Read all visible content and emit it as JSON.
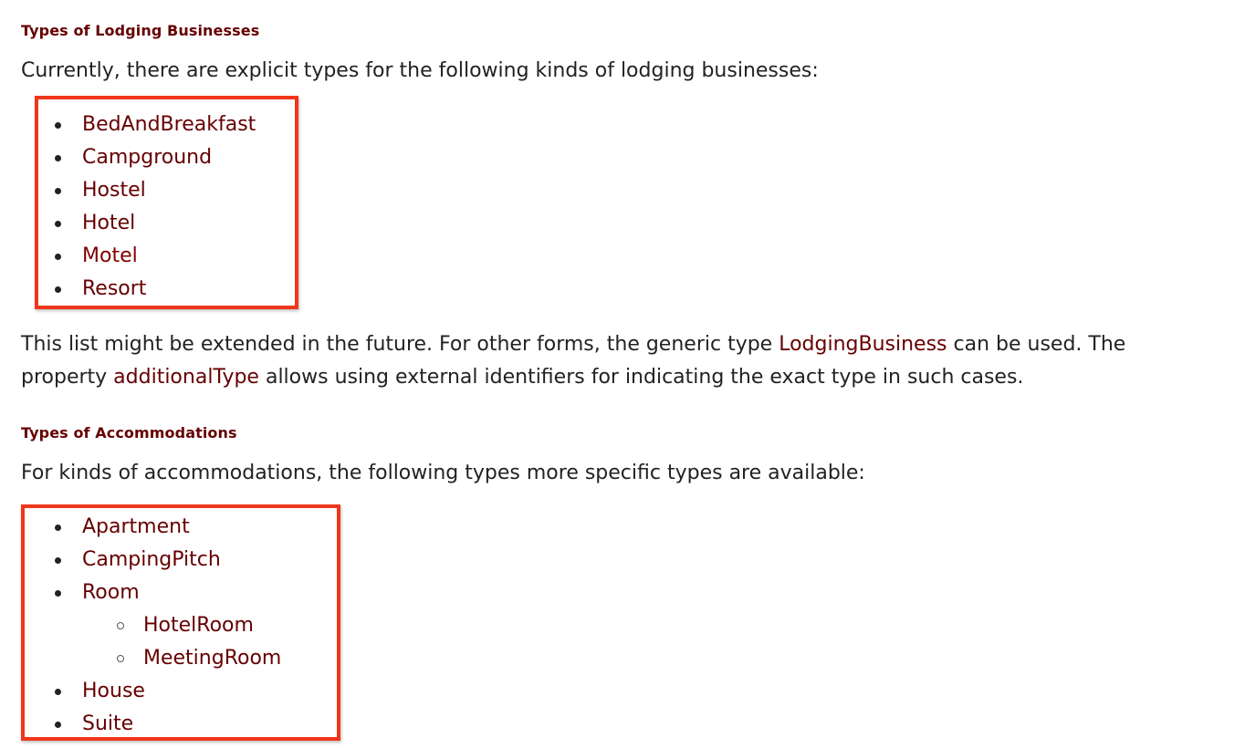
{
  "section1": {
    "heading": "Types of Lodging Businesses",
    "intro": "Currently, there are explicit types for the following kinds of lodging businesses:",
    "items": [
      "BedAndBreakfast",
      "Campground",
      "Hostel",
      "Hotel",
      "Motel",
      "Resort"
    ],
    "note": {
      "part1": "This list might be extended in the future. For other forms, the generic type ",
      "link1": "LodgingBusiness",
      "part2": " can be used. The",
      "part3": "property ",
      "link2": "additionalType",
      "part4": " allows using external identifiers for indicating the exact type in such cases."
    }
  },
  "section2": {
    "heading": "Types of Accommodations",
    "intro": "For kinds of accommodations, the following types more specific types are available:",
    "items": [
      {
        "label": "Apartment"
      },
      {
        "label": "CampingPitch"
      },
      {
        "label": "Room",
        "children": [
          "HotelRoom",
          "MeetingRoom"
        ]
      },
      {
        "label": "House"
      },
      {
        "label": "Suite"
      }
    ]
  },
  "colors": {
    "link": "#660000",
    "heading": "#660000",
    "text": "#222222",
    "highlight_box": "#f0361c"
  }
}
